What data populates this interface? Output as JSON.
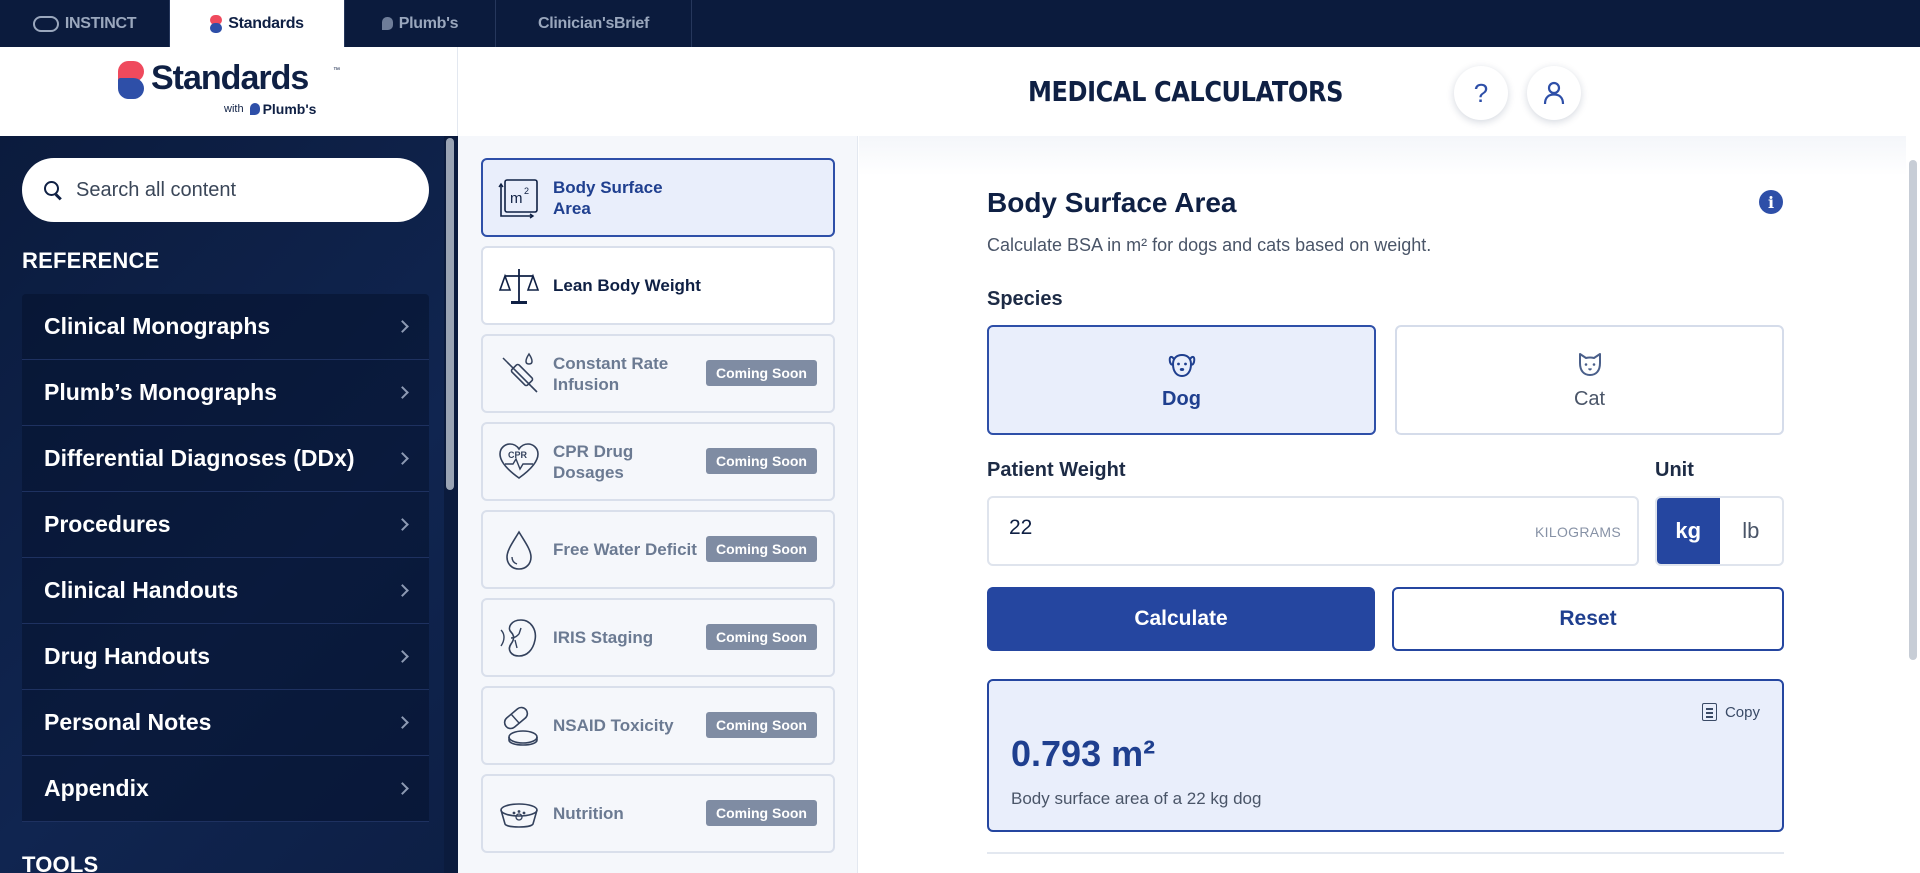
{
  "top_tabs": [
    {
      "label": "INSTINCT",
      "active": false
    },
    {
      "label": "Standards",
      "active": true
    },
    {
      "label": "Plumb's",
      "active": false
    },
    {
      "label": "Clinician'sBrief",
      "active": false
    }
  ],
  "brand": {
    "name": "Standards",
    "tm": "™",
    "sub_with": "with",
    "sub_brand": "Plumb's"
  },
  "header": {
    "title": "MEDICAL CALCULATORS",
    "help_glyph": "?",
    "help_icon": "help-icon",
    "account_icon": "user-icon"
  },
  "search": {
    "placeholder": "Search all content",
    "value": ""
  },
  "sidebar": {
    "reference_label": "REFERENCE",
    "reference_items": [
      {
        "label": "Clinical Monographs"
      },
      {
        "label": "Plumb’s Monographs"
      },
      {
        "label": "Differential Diagnoses (DDx)"
      },
      {
        "label": "Procedures"
      },
      {
        "label": "Clinical Handouts"
      },
      {
        "label": "Drug Handouts"
      },
      {
        "label": "Personal Notes"
      },
      {
        "label": "Appendix"
      }
    ],
    "tools_label": "TOOLS"
  },
  "calculators": [
    {
      "name": "Body Surface Area",
      "icon": "body-surface-area-icon",
      "state": "active",
      "badge": ""
    },
    {
      "name": "Lean Body Weight",
      "icon": "scale-icon",
      "state": "enabled",
      "badge": ""
    },
    {
      "name": "Constant Rate Infusion",
      "icon": "syringe-icon",
      "state": "disabled",
      "badge": "Coming Soon"
    },
    {
      "name": "CPR Drug Dosages",
      "icon": "heart-cpr-icon",
      "state": "disabled",
      "badge": "Coming Soon"
    },
    {
      "name": "Free Water Deficit",
      "icon": "water-drop-icon",
      "state": "disabled",
      "badge": "Coming Soon"
    },
    {
      "name": "IRIS Staging",
      "icon": "kidney-icon",
      "state": "disabled",
      "badge": "Coming Soon"
    },
    {
      "name": "NSAID Toxicity",
      "icon": "pill-icon",
      "state": "disabled",
      "badge": "Coming Soon"
    },
    {
      "name": "Nutrition",
      "icon": "pet-bowl-icon",
      "state": "disabled",
      "badge": "Coming Soon"
    }
  ],
  "form": {
    "title": "Body Surface Area",
    "description": "Calculate BSA in m² for dogs and cats based on weight.",
    "species_label": "Species",
    "species": [
      {
        "label": "Dog",
        "icon": "dog-icon",
        "selected": true
      },
      {
        "label": "Cat",
        "icon": "cat-icon",
        "selected": false
      }
    ],
    "weight_label": "Patient Weight",
    "weight_value": "22",
    "weight_suffix": "KILOGRAMS",
    "unit_label": "Unit",
    "units": [
      {
        "label": "kg",
        "selected": true
      },
      {
        "label": "lb",
        "selected": false
      }
    ],
    "calculate_label": "Calculate",
    "reset_label": "Reset"
  },
  "result": {
    "value": "0.793 m²",
    "caption": "Body surface area of a 22 kg dog",
    "copy_label": "Copy"
  },
  "colors": {
    "navy": "#0b1b3d",
    "primary": "#2546a0",
    "accent_red": "#ef4a5d",
    "selected_bg": "#e9eefb",
    "badge_gray": "#7f8ca3"
  }
}
